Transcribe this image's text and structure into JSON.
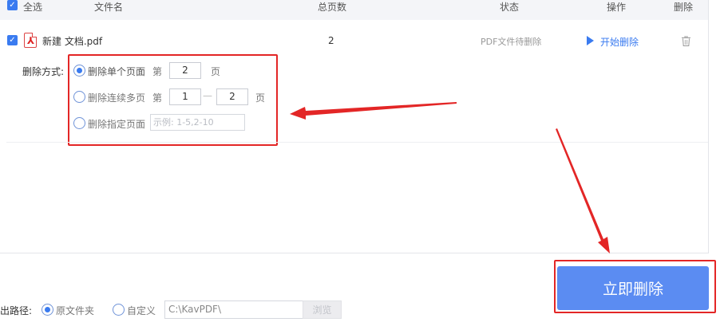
{
  "header": {
    "select_all": "全选",
    "col_filename": "文件名",
    "col_total_pages": "总页数",
    "col_status": "状态",
    "col_action": "操作",
    "col_delete": "删除"
  },
  "file": {
    "name": "新建 文档.pdf",
    "total_pages": "2",
    "status": "PDF文件待删除",
    "action_label": "开始删除"
  },
  "delete_mode": {
    "label": "删除方式:",
    "single": {
      "label": "删除单个页面",
      "prefix": "第",
      "value": "2",
      "suffix": "页",
      "selected": true
    },
    "range": {
      "label": "删除连续多页",
      "prefix": "第",
      "from": "1",
      "dash": "—",
      "to": "2",
      "suffix": "页",
      "selected": false
    },
    "custom": {
      "label": "删除指定页面",
      "placeholder": "示例: 1-5,2-10",
      "selected": false
    }
  },
  "output": {
    "label": "出路径:",
    "option_source": "原文件夹",
    "option_custom": "自定义",
    "path": "C:\\KavPDF\\",
    "browse": "浏览",
    "selected": "原文件夹"
  },
  "primary_button": "立即删除",
  "colors": {
    "accent": "#3a7bf0",
    "button": "#5b8cf2",
    "highlight_red": "#e32626"
  }
}
